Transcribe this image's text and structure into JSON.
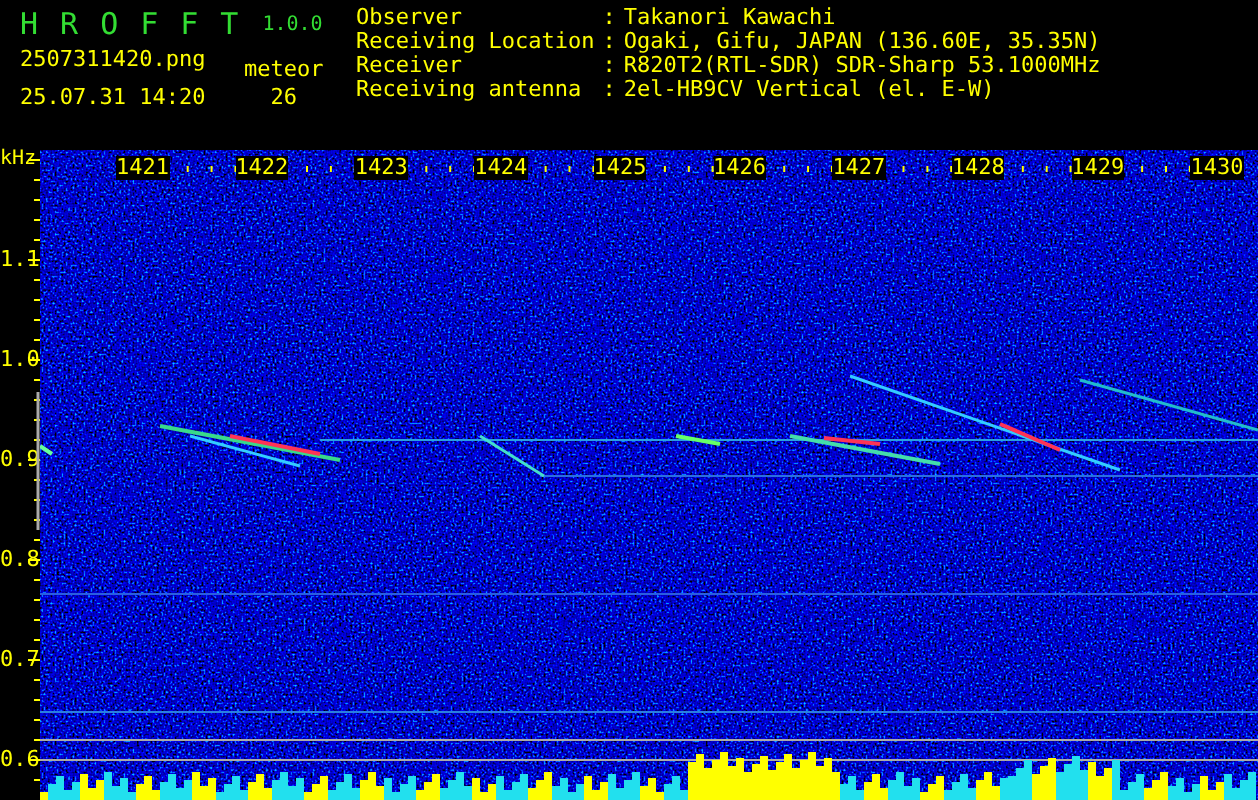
{
  "app": {
    "name_letters": [
      "H",
      "R",
      "O",
      "F",
      "F",
      "T"
    ],
    "version": "1.0.0"
  },
  "file": {
    "name": "2507311420.png",
    "datetime": "25.07.31 14:20"
  },
  "count": {
    "label": "meteor",
    "value": "26"
  },
  "station": [
    {
      "label": "Observer",
      "separator": ":",
      "value": "Takanori Kawachi"
    },
    {
      "label": "Receiving Location",
      "separator": ":",
      "value": "Ogaki, Gifu, JAPAN (136.60E, 35.35N)"
    },
    {
      "label": "Receiver",
      "separator": ":",
      "value": "R820T2(RTL-SDR) SDR-Sharp 53.1000MHz"
    },
    {
      "label": "Receiving antenna",
      "separator": ":",
      "value": "2el-HB9CV Vertical (el. E-W)"
    }
  ],
  "spectrogram": {
    "y_unit": "kHz",
    "x_labels": [
      "1421",
      "1422",
      "1423",
      "1424",
      "1425",
      "1426",
      "1427",
      "1428",
      "1429",
      "1430"
    ],
    "y_labels": [
      "1.1",
      "1.0",
      "0.9",
      "0.8",
      "0.7",
      "0.6"
    ]
  }
}
